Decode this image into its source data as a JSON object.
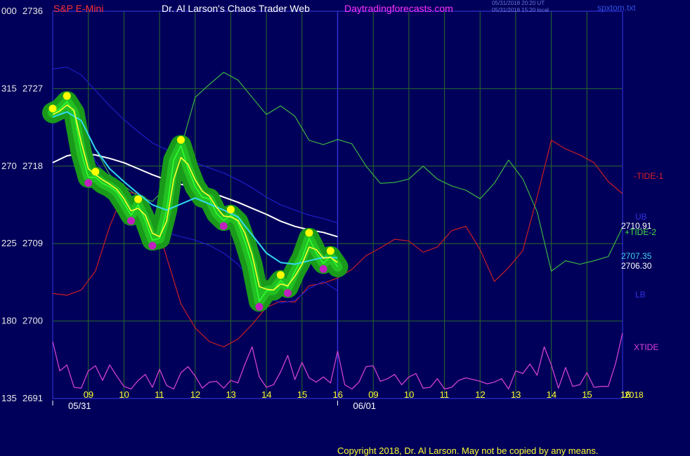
{
  "header": {
    "instrument": "S&P E-Mini",
    "title": "Dr. Al Larson's Chaos Trader Web",
    "site": "Daytradingforecasts.com",
    "timestamp_ut": "05/31/2018 20:20 UT",
    "timestamp_local": "05/31/2018 15:20 local",
    "file": "spxtom.txt"
  },
  "footer": {
    "copyright": "Copyright 2018, Dr. Al Larson. May not be copied by any means."
  },
  "colors": {
    "background": "#00005a",
    "grid": "#2a6a2a",
    "tide1": "#d92020",
    "tide2": "#40c040",
    "ub_lb": "#2020d0",
    "xtide": "#d040d0",
    "slow_avg": "#ffffff",
    "fast_avg": "#30d8f0",
    "signal": "#ffff30",
    "price": "#30ff30",
    "glow": "#1a9a1a",
    "high_dot": "#ffff00",
    "low_dot": "#c020c0"
  },
  "chart_data": {
    "type": "line",
    "title": "S&P E-Mini",
    "y_axis": {
      "price_ticks": [
        2736,
        2727,
        2718,
        2709,
        2700,
        2691
      ],
      "secondary_ticks": [
        "000",
        "315",
        "270",
        "225",
        "180",
        "135"
      ],
      "ylim": [
        2691,
        2736
      ]
    },
    "x_axis": {
      "hour_ticks_day1": [
        "09",
        "10",
        "11",
        "12",
        "13",
        "14",
        "15",
        "16"
      ],
      "hour_ticks_day2": [
        "09",
        "10",
        "11",
        "12",
        "13",
        "14",
        "15",
        "16"
      ],
      "date_labels": [
        "05/31",
        "06/01"
      ],
      "year_label": "2018",
      "xlim_hours": [
        8.0,
        24.0
      ]
    },
    "grid": true,
    "series_labels": {
      "tide1": "-TIDE-1",
      "tide2": "+TIDE-2",
      "ub": "UB",
      "lb": "LB",
      "xtide": "XTIDE"
    },
    "value_labels": {
      "tide2_end": "2710.91",
      "fast_end": "2707.35",
      "slow_end": "2706.30"
    },
    "series": [
      {
        "key": "price",
        "x": [
          8.0,
          8.2,
          8.4,
          8.6,
          8.8,
          9.0,
          9.2,
          9.4,
          9.6,
          9.8,
          10.0,
          10.2,
          10.4,
          10.6,
          10.8,
          11.0,
          11.2,
          11.4,
          11.6,
          11.8,
          12.0,
          12.2,
          12.4,
          12.6,
          12.8,
          13.0,
          13.2,
          13.4,
          13.6,
          13.8,
          14.0,
          14.2,
          14.4,
          14.6,
          14.8,
          15.0,
          15.2,
          15.4,
          15.6,
          15.8,
          16.0
        ],
        "values": [
          2724.2,
          2724.6,
          2725.5,
          2724.2,
          2719.6,
          2716.7,
          2716.7,
          2716.0,
          2715.6,
          2715.0,
          2713.7,
          2712.3,
          2713.5,
          2711.7,
          2709.4,
          2709.6,
          2712.9,
          2718.7,
          2720.4,
          2717.7,
          2715.6,
          2714.4,
          2714.2,
          2712.5,
          2711.7,
          2712.3,
          2711.5,
          2709.2,
          2706.5,
          2702.3,
          2703.5,
          2703.6,
          2704.7,
          2703.9,
          2705.8,
          2707.3,
          2709.6,
          2707.9,
          2706.7,
          2707.5,
          2706.3
        ]
      },
      {
        "key": "signal",
        "x": [
          8.0,
          8.2,
          8.4,
          8.6,
          8.8,
          9.0,
          9.2,
          9.4,
          9.6,
          9.8,
          10.0,
          10.2,
          10.4,
          10.6,
          10.8,
          11.0,
          11.2,
          11.4,
          11.6,
          11.8,
          12.0,
          12.2,
          12.4,
          12.6,
          12.8,
          13.0,
          13.2,
          13.4,
          13.6,
          13.8,
          14.0,
          14.2,
          14.4,
          14.6,
          14.8,
          15.0,
          15.2,
          15.4,
          15.6,
          15.8,
          16.0
        ],
        "values": [
          2724.0,
          2724.4,
          2725.1,
          2724.5,
          2720.8,
          2717.7,
          2717.0,
          2716.4,
          2715.9,
          2715.3,
          2714.2,
          2712.8,
          2713.1,
          2712.3,
          2710.2,
          2709.8,
          2711.6,
          2716.5,
          2719.0,
          2718.2,
          2716.4,
          2715.1,
          2714.5,
          2713.2,
          2712.2,
          2712.1,
          2711.7,
          2710.2,
          2707.7,
          2704.0,
          2703.7,
          2703.6,
          2704.3,
          2704.1,
          2705.2,
          2706.6,
          2708.6,
          2708.3,
          2707.3,
          2707.4,
          2706.8
        ]
      },
      {
        "key": "fast_avg",
        "x": [
          8.0,
          8.4,
          8.8,
          9.2,
          9.6,
          10.0,
          10.4,
          10.8,
          11.2,
          11.6,
          12.0,
          12.4,
          12.8,
          13.2,
          13.6,
          14.0,
          14.4,
          14.8,
          15.2,
          15.6,
          16.0
        ],
        "values": [
          2723.7,
          2724.3,
          2723.3,
          2720.0,
          2717.7,
          2716.2,
          2714.8,
          2713.5,
          2712.9,
          2713.6,
          2714.3,
          2713.6,
          2712.9,
          2712.1,
          2710.0,
          2707.9,
          2706.8,
          2706.6,
          2707.0,
          2707.4,
          2707.35
        ]
      },
      {
        "key": "slow_avg",
        "x": [
          8.0,
          8.4,
          8.8,
          9.2,
          9.6,
          10.0,
          10.4,
          10.8,
          11.2,
          11.6,
          12.0,
          12.4,
          12.8,
          13.2,
          13.6,
          14.0,
          14.4,
          14.8,
          15.2,
          15.6,
          16.0
        ],
        "values": [
          2718.4,
          2719.2,
          2719.5,
          2719.3,
          2718.9,
          2718.4,
          2717.7,
          2717.0,
          2716.4,
          2715.9,
          2715.5,
          2715.0,
          2714.4,
          2713.8,
          2713.1,
          2712.4,
          2711.6,
          2711.0,
          2710.6,
          2710.3,
          2709.8
        ]
      },
      {
        "key": "ub",
        "x": [
          8.0,
          8.4,
          8.8,
          9.2,
          9.6,
          10.0,
          10.4,
          10.8,
          11.2,
          11.6,
          12.0,
          12.4,
          12.8,
          13.2,
          13.6,
          14.0,
          14.4,
          14.8,
          15.2,
          15.6,
          16.0
        ],
        "values": [
          2729.3,
          2729.5,
          2728.6,
          2726.8,
          2725.0,
          2723.4,
          2722.0,
          2720.7,
          2719.9,
          2719.0,
          2718.4,
          2717.8,
          2717.2,
          2716.4,
          2715.5,
          2714.4,
          2713.5,
          2712.9,
          2712.3,
          2711.9,
          2711.4
        ]
      },
      {
        "key": "lb",
        "x": [
          8.0,
          8.4,
          8.8,
          9.2,
          9.6,
          10.0,
          10.4,
          10.8,
          11.2,
          11.6,
          12.0,
          12.4,
          12.8,
          13.2,
          13.6,
          14.0,
          14.4,
          14.8,
          15.2,
          15.6,
          16.0
        ],
        "values": [
          2724.6,
          2724.4,
          2722.4,
          2718.6,
          2716.4,
          2714.4,
          2712.8,
          2711.3,
          2710.3,
          2709.8,
          2709.4,
          2708.8,
          2707.9,
          2706.6,
          2704.7,
          2702.9,
          2702.1,
          2702.4,
          2703.8,
          2704.6,
          2703.5
        ]
      },
      {
        "key": "tide1",
        "x": [
          8.0,
          8.4,
          8.8,
          9.2,
          9.6,
          10.0,
          10.4,
          10.8,
          11.2,
          11.6,
          12.0,
          12.4,
          12.8,
          13.2,
          13.6,
          14.0,
          14.4,
          14.8,
          15.2,
          15.6,
          16.0,
          16.4,
          16.8,
          17.2,
          17.6,
          18.0,
          18.4,
          18.8,
          19.2,
          19.6,
          20.0,
          20.4,
          20.8,
          21.2,
          21.6,
          22.0,
          22.4,
          22.8,
          23.2,
          23.6,
          24.0
        ],
        "values": [
          2703.2,
          2703.0,
          2703.6,
          2705.8,
          2711.0,
          2715.0,
          2714.8,
          2712.8,
          2707.4,
          2702.0,
          2699.2,
          2697.6,
          2697.0,
          2697.9,
          2699.6,
          2701.6,
          2702.3,
          2702.2,
          2704.1,
          2704.4,
          2705.0,
          2706.0,
          2707.6,
          2708.5,
          2709.5,
          2709.3,
          2708.0,
          2708.6,
          2710.5,
          2711.0,
          2708.3,
          2704.6,
          2706.2,
          2708.2,
          2714.4,
          2721.0,
          2720.0,
          2719.3,
          2718.4,
          2716.2,
          2714.8
        ]
      },
      {
        "key": "tide2",
        "x": [
          8.0,
          8.4,
          8.8,
          9.2,
          9.6,
          10.0,
          10.4,
          10.8,
          11.2,
          11.6,
          12.0,
          12.4,
          12.8,
          13.2,
          13.6,
          14.0,
          14.4,
          14.8,
          15.2,
          15.6,
          16.0,
          16.4,
          16.8,
          17.2,
          17.6,
          18.0,
          18.4,
          18.8,
          19.2,
          19.6,
          20.0,
          20.4,
          20.8,
          21.2,
          21.6,
          22.0,
          22.4,
          22.8,
          23.2,
          23.6,
          24.0
        ],
        "values": [
          2724.0,
          2724.6,
          2723.0,
          2720.0,
          2717.0,
          2715.7,
          2714.5,
          2713.9,
          2715.6,
          2720.1,
          2726.0,
          2727.5,
          2728.9,
          2728.0,
          2726.0,
          2724.0,
          2725.0,
          2723.8,
          2721.0,
          2720.5,
          2721.1,
          2720.6,
          2718.0,
          2716.0,
          2716.1,
          2716.5,
          2718.0,
          2716.5,
          2715.7,
          2715.2,
          2714.2,
          2716.0,
          2718.7,
          2716.5,
          2712.7,
          2705.8,
          2707.0,
          2706.6,
          2707.0,
          2707.5,
          2710.91
        ]
      },
      {
        "key": "xtide",
        "x": [
          8.0,
          8.2,
          8.4,
          8.6,
          8.8,
          9.0,
          9.2,
          9.4,
          9.6,
          9.8,
          10.0,
          10.2,
          10.4,
          10.6,
          10.8,
          11.0,
          11.2,
          11.4,
          11.6,
          11.8,
          12.0,
          12.2,
          12.4,
          12.6,
          12.8,
          13.0,
          13.2,
          13.4,
          13.6,
          13.8,
          14.0,
          14.2,
          14.4,
          14.6,
          14.8,
          15.0,
          15.2,
          15.4,
          15.6,
          15.8,
          16.0,
          16.2,
          16.4,
          16.6,
          16.8,
          17.0,
          17.2,
          17.4,
          17.6,
          17.8,
          18.0,
          18.2,
          18.4,
          18.6,
          18.8,
          19.0,
          19.2,
          19.4,
          19.6,
          19.8,
          20.0,
          20.2,
          20.4,
          20.6,
          20.8,
          21.0,
          21.2,
          21.4,
          21.6,
          21.8,
          22.0,
          22.2,
          22.4,
          22.6,
          22.8,
          23.0,
          23.2,
          23.4,
          23.6,
          23.8,
          24.0
        ],
        "values": [
          2697.6,
          2694.2,
          2694.9,
          2692.3,
          2692.2,
          2694.2,
          2694.8,
          2693.1,
          2694.9,
          2693.6,
          2692.4,
          2692.1,
          2693.1,
          2693.8,
          2692.3,
          2694.4,
          2692.5,
          2692.1,
          2694.0,
          2694.7,
          2693.6,
          2692.2,
          2692.9,
          2693.0,
          2692.2,
          2693.1,
          2692.8,
          2695.0,
          2697.0,
          2693.5,
          2692.3,
          2692.6,
          2694.1,
          2696.0,
          2693.2,
          2695.2,
          2693.4,
          2692.9,
          2693.5,
          2692.8,
          2696.5,
          2692.6,
          2692.1,
          2692.9,
          2694.7,
          2694.8,
          2693.0,
          2693.3,
          2693.8,
          2692.6,
          2693.5,
          2693.9,
          2692.2,
          2692.3,
          2693.3,
          2692.1,
          2692.3,
          2693.1,
          2693.4,
          2693.2,
          2693.0,
          2692.7,
          2692.9,
          2693.3,
          2692.1,
          2694.2,
          2693.9,
          2695.0,
          2693.7,
          2697.0,
          2694.9,
          2692.2,
          2694.6,
          2692.4,
          2692.6,
          2694.0,
          2692.3,
          2692.4,
          2692.4,
          2695.0,
          2698.6
        ]
      }
    ]
  }
}
